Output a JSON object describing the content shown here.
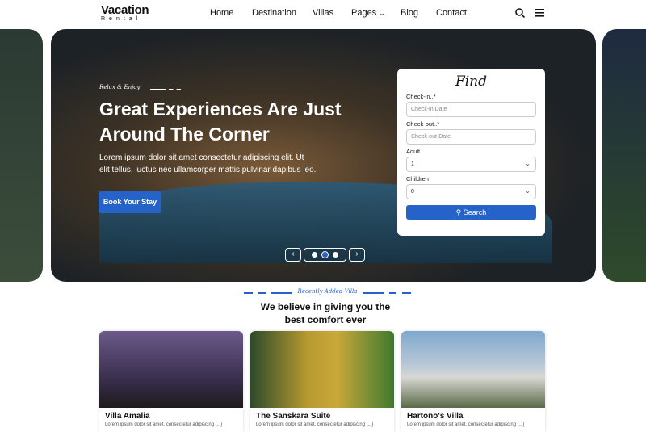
{
  "brand": {
    "title": "Vacation",
    "subtitle": "Rental"
  },
  "nav": {
    "items": [
      "Home",
      "Destination",
      "Villas",
      "Pages",
      "Blog",
      "Contact"
    ]
  },
  "hero": {
    "tagline": "Relax & Enjoy",
    "title_line1": "Great Experiences Are Just",
    "title_line2": "Around The Corner",
    "text_line1": "Lorem ipsum dolor sit amet consectetur adipiscing elit. Ut",
    "text_line2": "elit tellus, luctus nec ullamcorper mattis pulvinar dapibus leo.",
    "cta": "Book Your Stay",
    "slides": 3,
    "active_slide": 2
  },
  "find": {
    "title": "Find",
    "checkin_label": "Check-in..*",
    "checkin_placeholder": "Check-in Date",
    "checkout_label": "Check-out..*",
    "checkout_placeholder": "Check-out-Date",
    "adult_label": "Adult",
    "adult_value": "1",
    "children_label": "Children",
    "children_value": "0",
    "search": "Search"
  },
  "section": {
    "kicker": "Recently Added Villa",
    "heading_line1": "We believe in giving you the",
    "heading_line2": "best comfort ever"
  },
  "cards": [
    {
      "title": "Villa Amalia",
      "desc": "Lorem ipsum dolor sit amet, consectetur adipiscing [...]"
    },
    {
      "title": "The Sanskara Suite",
      "desc": "Lorem ipsum dolor sit amet, consectetur adipiscing [...]"
    },
    {
      "title": "Hartono's Villa",
      "desc": "Lorem ipsum dolor sit amet, consectetur adipiscing [...]"
    }
  ],
  "colors": {
    "accent": "#2563c9"
  }
}
